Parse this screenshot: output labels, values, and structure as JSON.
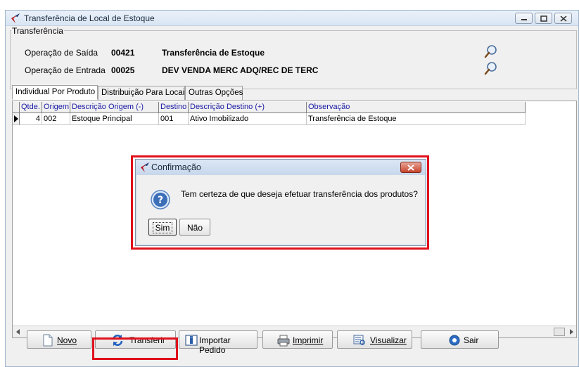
{
  "window": {
    "title": "Transferência de Local de Estoque"
  },
  "transferencia": {
    "legend": "Transferência",
    "saida": {
      "label": "Operação de Saída",
      "code": "00421",
      "description": "Transferência de Estoque"
    },
    "entrada": {
      "label": "Operação de Entrada",
      "code": "00025",
      "description": "DEV VENDA MERC ADQ/REC DE TERC"
    }
  },
  "tabs": [
    {
      "label": "Individual Por Produto",
      "active": true
    },
    {
      "label": "Distribuição Para Locais",
      "active": false
    },
    {
      "label": "Outras Opções",
      "active": false
    }
  ],
  "grid": {
    "headers": [
      "Qtde.",
      "Origem",
      "Descrição Origem (-)",
      "Destino",
      "Descrição Destino (+)",
      "Observação"
    ],
    "rows": [
      [
        "4",
        "002",
        "Estoque Principal",
        "001",
        "Ativo Imobilizado",
        "Transferência de Estoque"
      ]
    ]
  },
  "dialog": {
    "title": "Confirmação",
    "message": "Tem certeza de que deseja efetuar transferência dos produtos?",
    "yes": "Sim",
    "no": "Não"
  },
  "toolbar": {
    "novo": "Novo",
    "transferir": "Transferir",
    "importar": "Importar Pedido",
    "imprimir": "Imprimir",
    "visualizar": "Visualizar",
    "sair": "Sair"
  },
  "colors": {
    "highlight": "#e0101c",
    "header_text": "#1a1aa6"
  }
}
